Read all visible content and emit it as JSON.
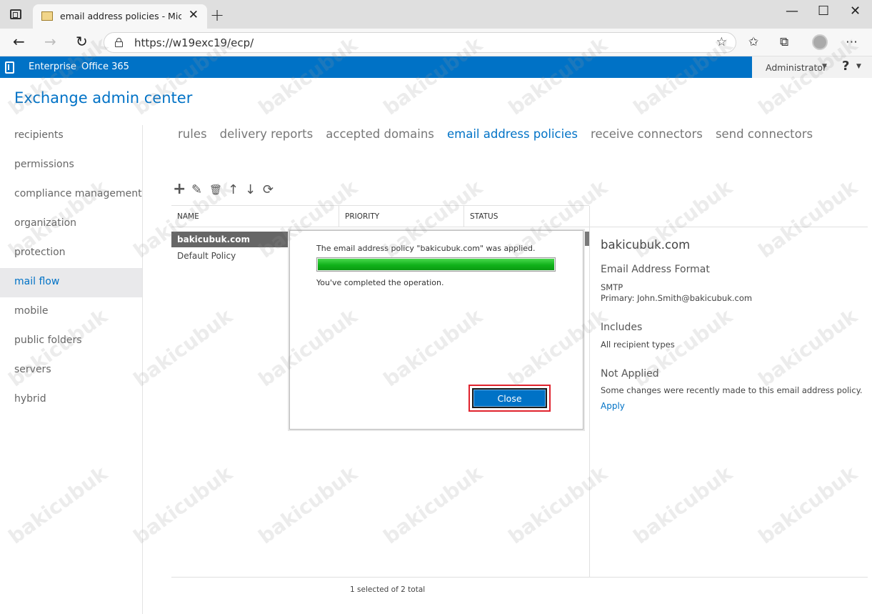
{
  "browser": {
    "tab_title": "email address policies - Microsoft",
    "tab_close": "✕",
    "new_tab": "+",
    "url": "https://w19exc19/ecp/",
    "window_controls": {
      "minimize": "—",
      "maximize": "☐",
      "close": "✕"
    }
  },
  "header": {
    "links": [
      "Enterprise",
      "Office 365"
    ],
    "user": "Administrator",
    "help": "?"
  },
  "app_title": "Exchange admin center",
  "leftnav": {
    "items": [
      {
        "label": "recipients"
      },
      {
        "label": "permissions"
      },
      {
        "label": "compliance management"
      },
      {
        "label": "organization"
      },
      {
        "label": "protection"
      },
      {
        "label": "mail flow",
        "active": true
      },
      {
        "label": "mobile"
      },
      {
        "label": "public folders"
      },
      {
        "label": "servers"
      },
      {
        "label": "hybrid"
      }
    ]
  },
  "subtabs": [
    {
      "label": "rules"
    },
    {
      "label": "delivery reports"
    },
    {
      "label": "accepted domains"
    },
    {
      "label": "email address policies",
      "active": true
    },
    {
      "label": "receive connectors"
    },
    {
      "label": "send connectors"
    }
  ],
  "toolbar_icons": [
    "add-icon",
    "edit-icon",
    "delete-icon",
    "move-up-icon",
    "move-down-icon",
    "refresh-icon"
  ],
  "list": {
    "columns": [
      "NAME",
      "PRIORITY",
      "STATUS"
    ],
    "rows": [
      {
        "name": "bakicubuk.com",
        "selected": true
      },
      {
        "name": "Default Policy",
        "selected": false
      }
    ],
    "footer": "1 selected of 2 total"
  },
  "details": {
    "title": "bakicubuk.com",
    "format_heading": "Email Address Format",
    "format_type": "SMTP",
    "format_value": "Primary: John.Smith@bakicubuk.com",
    "includes_heading": "Includes",
    "includes_value": "All recipient types",
    "status_heading": "Not Applied",
    "status_text": "Some changes were recently made to this email address policy.",
    "apply_link": "Apply"
  },
  "dialog": {
    "message": "The email address policy \"bakicubuk.com\" was applied.",
    "progress_fraction": 1.0,
    "done_text": "You've completed the operation.",
    "close_label": "Close"
  },
  "watermark": "bakicubuk",
  "colors": {
    "accent": "#0072c6",
    "progress": "#10b21a",
    "highlight": "#e0222d"
  }
}
